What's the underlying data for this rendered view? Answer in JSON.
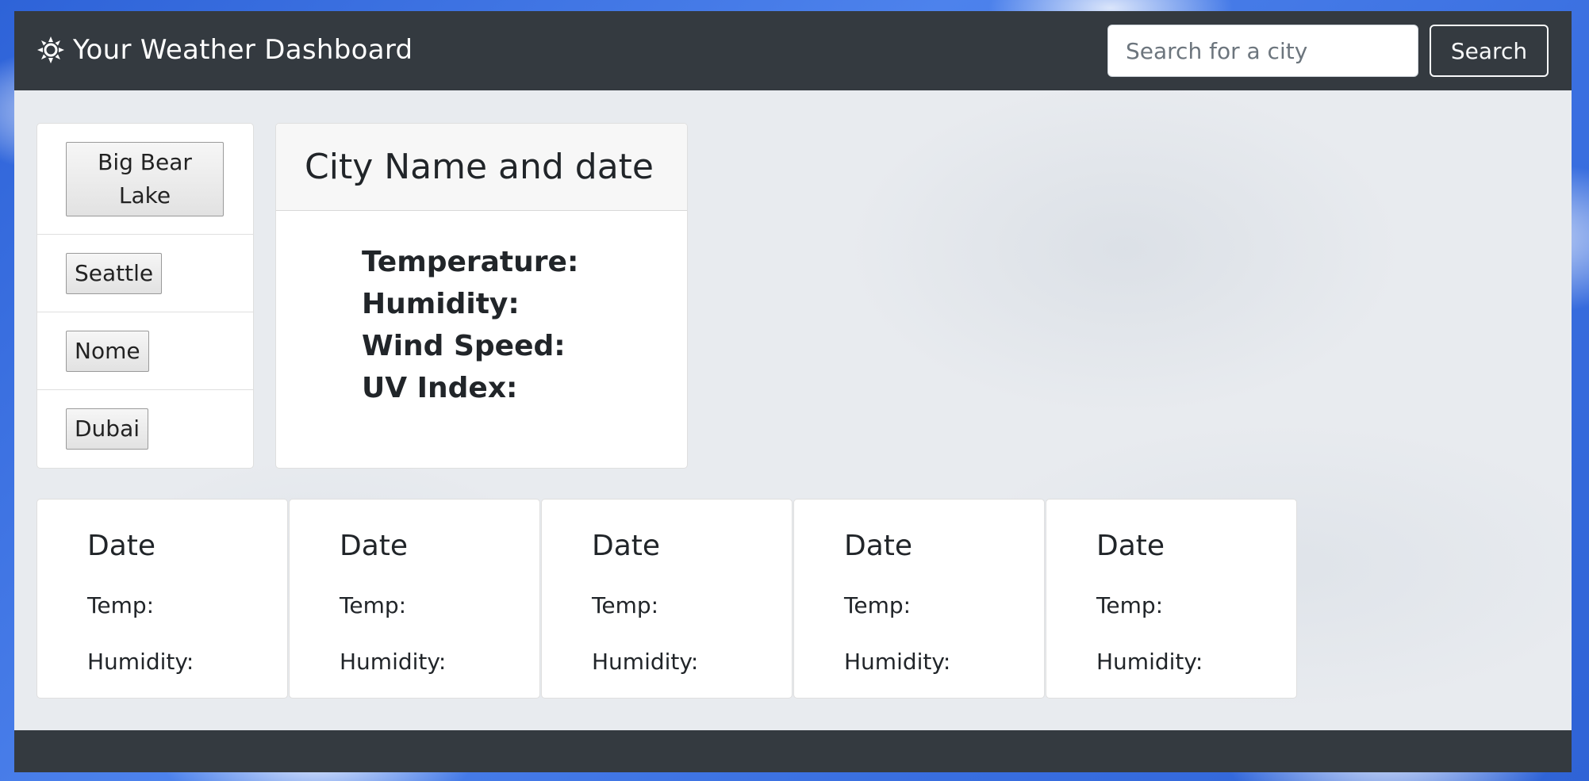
{
  "header": {
    "title": "Your Weather Dashboard",
    "icon": "sun-icon"
  },
  "search": {
    "placeholder": "Search for a city",
    "value": "",
    "button_label": "Search"
  },
  "history": {
    "cities": [
      "Big Bear Lake",
      "Seattle",
      "Nome",
      "Dubai"
    ]
  },
  "current": {
    "heading": "City Name and date",
    "temperature_label": "Temperature:",
    "humidity_label": "Humidity:",
    "wind_label": "Wind Speed:",
    "uv_label": "UV Index:"
  },
  "forecast": [
    {
      "date": "Date",
      "temp_label": "Temp:",
      "humidity_label": "Humidity:"
    },
    {
      "date": "Date",
      "temp_label": "Temp:",
      "humidity_label": "Humidity:"
    },
    {
      "date": "Date",
      "temp_label": "Temp:",
      "humidity_label": "Humidity:"
    },
    {
      "date": "Date",
      "temp_label": "Temp:",
      "humidity_label": "Humidity:"
    },
    {
      "date": "Date",
      "temp_label": "Temp:",
      "humidity_label": "Humidity:"
    }
  ],
  "colors": {
    "navbar": "#343a40",
    "page_background": "#e8ebef",
    "sky": "#3a6fe0"
  }
}
